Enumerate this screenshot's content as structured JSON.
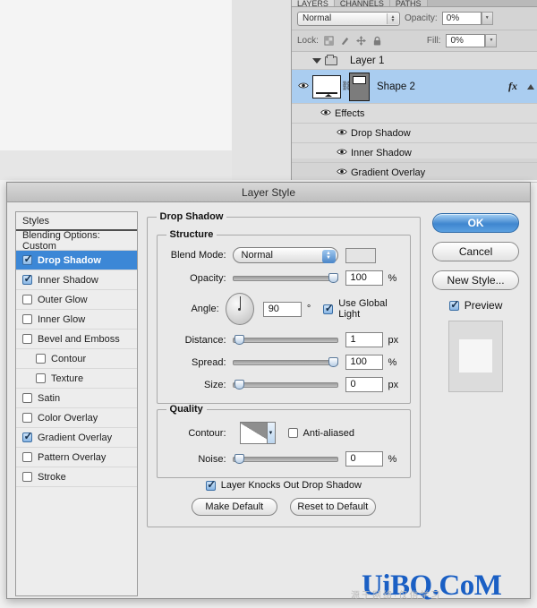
{
  "layers_panel": {
    "tabs": [
      {
        "label": "LAYERS",
        "active": true
      },
      {
        "label": "CHANNELS",
        "active": false
      },
      {
        "label": "PATHS",
        "active": false
      }
    ],
    "blend_mode": "Normal",
    "opacity_label": "Opacity:",
    "opacity_value": "0%",
    "lock_label": "Lock:",
    "lock_icons": [
      "transparency-lock-icon",
      "brush-lock-icon",
      "move-lock-icon",
      "all-lock-icon"
    ],
    "fill_label": "Fill:",
    "fill_value": "0%",
    "group_name": "Layer 1",
    "layer_name": "Shape 2",
    "fx_badge": "fx",
    "effects_label": "Effects",
    "effects": [
      "Drop Shadow",
      "Inner Shadow",
      "Gradient Overlay"
    ]
  },
  "dialog": {
    "title": "Layer Style",
    "styles": {
      "header": "Styles",
      "blending_options": "Blending Options: Custom",
      "items": [
        {
          "label": "Drop Shadow",
          "checked": true,
          "selected": true,
          "indent": false
        },
        {
          "label": "Inner Shadow",
          "checked": true,
          "selected": false,
          "indent": false
        },
        {
          "label": "Outer Glow",
          "checked": false,
          "selected": false,
          "indent": false
        },
        {
          "label": "Inner Glow",
          "checked": false,
          "selected": false,
          "indent": false
        },
        {
          "label": "Bevel and Emboss",
          "checked": false,
          "selected": false,
          "indent": false
        },
        {
          "label": "Contour",
          "checked": false,
          "selected": false,
          "indent": true
        },
        {
          "label": "Texture",
          "checked": false,
          "selected": false,
          "indent": true
        },
        {
          "label": "Satin",
          "checked": false,
          "selected": false,
          "indent": false
        },
        {
          "label": "Color Overlay",
          "checked": false,
          "selected": false,
          "indent": false
        },
        {
          "label": "Gradient Overlay",
          "checked": true,
          "selected": false,
          "indent": false
        },
        {
          "label": "Pattern Overlay",
          "checked": false,
          "selected": false,
          "indent": false
        },
        {
          "label": "Stroke",
          "checked": false,
          "selected": false,
          "indent": false
        }
      ]
    },
    "drop_shadow": {
      "group_title": "Drop Shadow",
      "structure": {
        "title": "Structure",
        "blend_mode_label": "Blend Mode:",
        "blend_mode_value": "Normal",
        "color_swatch": "#e4e4e4",
        "opacity_label": "Opacity:",
        "opacity_value": "100",
        "opacity_unit": "%",
        "opacity_percent": 100,
        "angle_label": "Angle:",
        "angle_value": "90",
        "angle_unit": "°",
        "use_global_light_label": "Use Global Light",
        "use_global_light_checked": true,
        "distance_label": "Distance:",
        "distance_value": "1",
        "distance_unit": "px",
        "distance_percent": 2,
        "spread_label": "Spread:",
        "spread_value": "100",
        "spread_unit": "%",
        "spread_percent": 100,
        "size_label": "Size:",
        "size_value": "0",
        "size_unit": "px",
        "size_percent": 0
      },
      "quality": {
        "title": "Quality",
        "contour_label": "Contour:",
        "anti_aliased_label": "Anti-aliased",
        "anti_aliased_checked": false,
        "noise_label": "Noise:",
        "noise_value": "0",
        "noise_unit": "%",
        "noise_percent": 0
      },
      "knockout_label": "Layer Knocks Out Drop Shadow",
      "knockout_checked": true,
      "make_default_label": "Make Default",
      "reset_default_label": "Reset to Default"
    },
    "buttons": {
      "ok": "OK",
      "cancel": "Cancel",
      "new_style": "New Style...",
      "preview_label": "Preview",
      "preview_checked": true
    }
  },
  "watermark": {
    "text": "UiBQ.CoM",
    "subtext": "源于网络·仅供学习"
  }
}
